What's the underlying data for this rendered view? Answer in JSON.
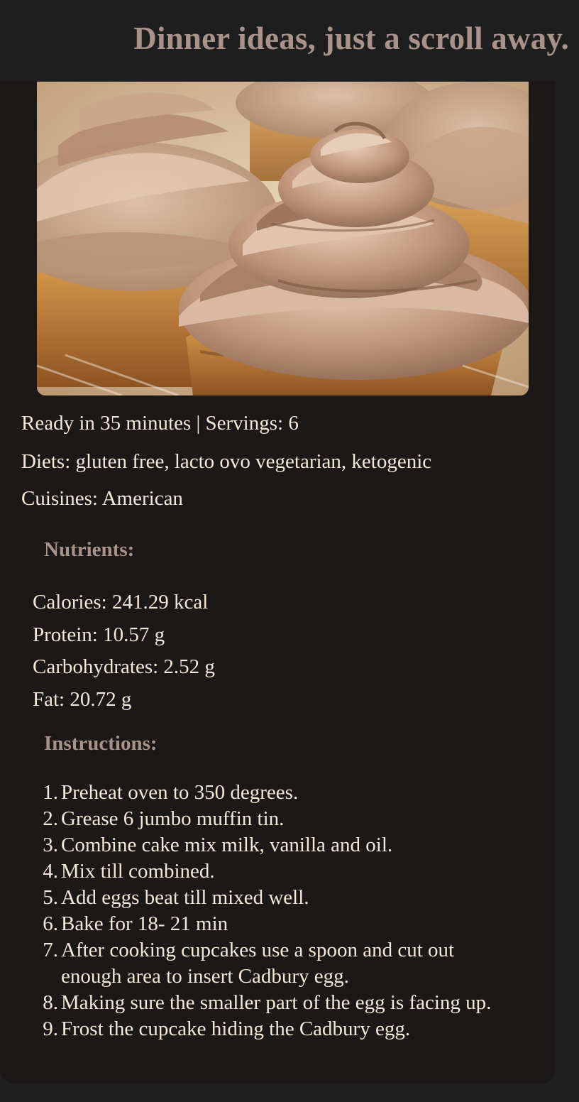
{
  "header": {
    "title": "Dinner ideas, just a scroll away."
  },
  "recipe": {
    "image_icon": "cupcake-photo",
    "meta_time_servings": "Ready in 35 minutes | Servings: 6",
    "meta_diets": "Diets: gluten free, lacto ovo vegetarian, ketogenic",
    "meta_cuisines": "Cuisines: American",
    "nutrients_heading": "Nutrients:",
    "nutrients": [
      "Calories: 241.29 kcal",
      "Protein: 10.57 g",
      "Carbohydrates: 2.52 g",
      "Fat: 20.72 g"
    ],
    "instructions_heading": "Instructions:",
    "steps": [
      {
        "num": "1.",
        "text": "Preheat oven to 350 degrees."
      },
      {
        "num": "2.",
        "text": "Grease 6 jumbo muffin tin."
      },
      {
        "num": "3.",
        "text": "Combine cake mix milk, vanilla and oil."
      },
      {
        "num": "4.",
        "text": "Mix till combined."
      },
      {
        "num": "5.",
        "text": "Add eggs beat till mixed well."
      },
      {
        "num": "6.",
        "text": "Bake for 18- 21 min"
      },
      {
        "num": "7.",
        "text": "After cooking cupcakes use a spoon and cut out enough area to insert Cadbury egg."
      },
      {
        "num": "8.",
        "text": "Making sure the smaller part of the egg is facing up."
      },
      {
        "num": "9.",
        "text": "Frost the cupcake hiding the Cadbury egg."
      }
    ]
  },
  "colors": {
    "page_background": "#1f1f1f",
    "card_background": "#1b1817",
    "heading": "#a9928a",
    "body_text": "#f4e8d8"
  }
}
